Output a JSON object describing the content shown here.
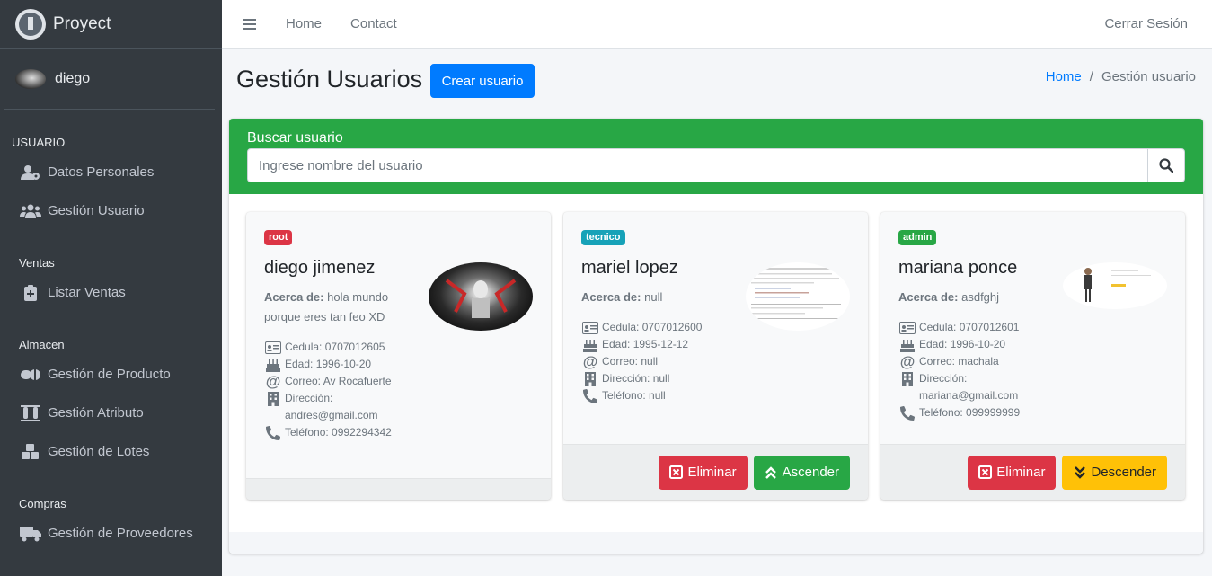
{
  "brand": {
    "name": "Proyect",
    "logo_icon": "brand-logo-icon"
  },
  "user": {
    "name": "diego"
  },
  "sidebar": {
    "sections": [
      {
        "header": "USUARIO",
        "items": [
          {
            "label": "Datos Personales",
            "icon": "user-cog-icon"
          },
          {
            "label": "Gestión Usuario",
            "icon": "users-icon"
          }
        ]
      },
      {
        "header": "Ventas",
        "items": [
          {
            "label": "Listar Ventas",
            "icon": "clipboard-plus-icon"
          }
        ]
      },
      {
        "header": "Almacen",
        "items": [
          {
            "label": "Gestión de Producto",
            "icon": "pills-icon"
          },
          {
            "label": "Gestión Atributo",
            "icon": "vials-icon"
          },
          {
            "label": "Gestión de Lotes",
            "icon": "cubes-icon"
          }
        ]
      },
      {
        "header": "Compras",
        "items": [
          {
            "label": "Gestión de Proveedores",
            "icon": "truck-icon"
          }
        ]
      }
    ]
  },
  "topnav": {
    "home": "Home",
    "contact": "Contact",
    "logout": "Cerrar Sesión"
  },
  "header": {
    "title": "Gestión Usuarios",
    "create_button": "Crear usuario"
  },
  "breadcrumb": {
    "home": "Home",
    "separator": "/",
    "current": "Gestión usuario"
  },
  "search": {
    "title": "Buscar usuario",
    "placeholder": "Ingrese nombre del usuario"
  },
  "labels": {
    "about": "Acerca de:",
    "cedula": "Cedula:",
    "edad": "Edad:",
    "correo": "Correo:",
    "direccion": "Dirección:",
    "telefono": "Teléfono:"
  },
  "cards": [
    {
      "role": "root",
      "name": "diego jimenez",
      "about": "hola mundo porque eres tan feo XD",
      "cedula": "0707012605",
      "edad": "1996-10-20",
      "correo": "Av Rocafuerte",
      "direccion": "andres@gmail.com",
      "telefono": "0992294342"
    },
    {
      "role": "tecnico",
      "name": "mariel lopez",
      "about": "null",
      "cedula": "0707012600",
      "edad": "1995-12-12",
      "correo": "null",
      "direccion": "null",
      "telefono": "null",
      "actions": {
        "delete": "Eliminar",
        "promote": "Ascender"
      }
    },
    {
      "role": "admin",
      "name": "mariana ponce",
      "about": "asdfghj",
      "cedula": "0707012601",
      "edad": "1996-10-20",
      "correo": "machala",
      "direccion": "mariana@gmail.com",
      "telefono": "099999999",
      "actions": {
        "delete": "Eliminar",
        "demote": "Descender"
      }
    }
  ],
  "colors": {
    "sidebar": "#343a40",
    "primary": "#007bff",
    "success": "#28a745",
    "danger": "#dc3545",
    "warning": "#ffc107",
    "info": "#17a2b8"
  }
}
